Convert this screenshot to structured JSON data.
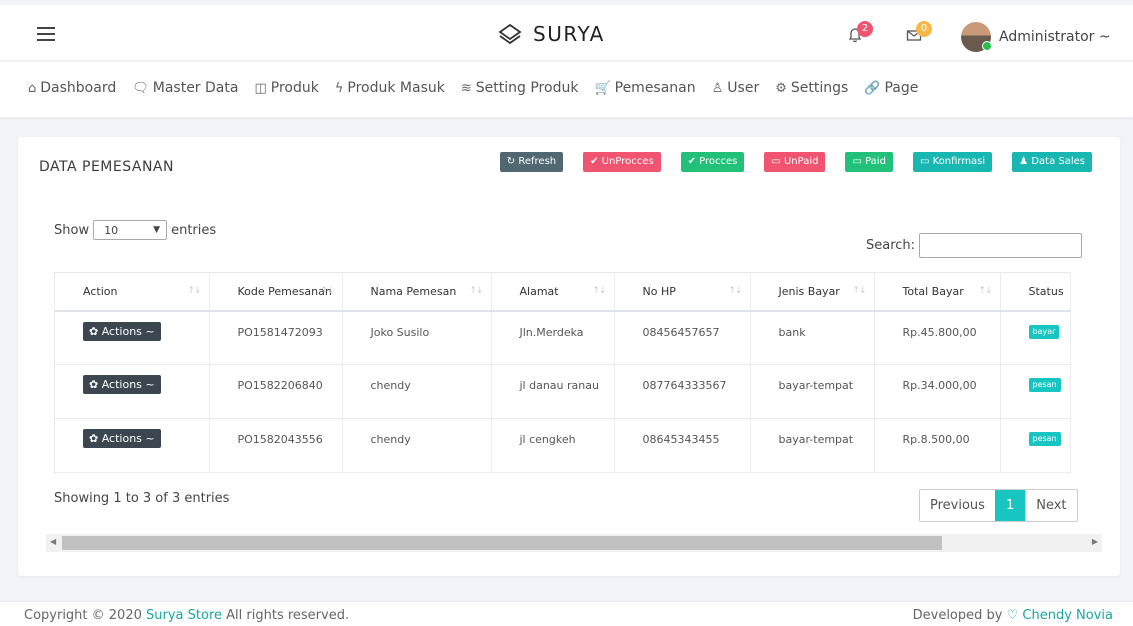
{
  "header": {
    "brand": "SURYA",
    "notif_count": "2",
    "mail_count": "0",
    "user": "Administrator ~"
  },
  "menu": [
    {
      "icon": "⌂",
      "icon_name": "home-icon",
      "label": "Dashboard"
    },
    {
      "icon": "🗨",
      "icon_name": "monitor-icon",
      "label": "Master Data"
    },
    {
      "icon": "◫",
      "icon_name": "grid-icon",
      "label": "Produk"
    },
    {
      "icon": "ϟ",
      "icon_name": "bolt-icon",
      "label": "Produk Masuk"
    },
    {
      "icon": "≋",
      "icon_name": "layers-icon",
      "label": "Setting Produk"
    },
    {
      "icon": "🛒",
      "icon_name": "cart-icon",
      "label": "Pemesanan"
    },
    {
      "icon": "♙",
      "icon_name": "user-icon",
      "label": "User"
    },
    {
      "icon": "⚙",
      "icon_name": "gear-icon",
      "label": "Settings"
    },
    {
      "icon": "🔗",
      "icon_name": "link-icon",
      "label": "Page"
    }
  ],
  "card": {
    "title": "DATA PEMESANAN",
    "buttons": [
      {
        "label": "↻ Refresh",
        "color": "#516872",
        "name": "refresh-button"
      },
      {
        "label": "✔ UnProcces",
        "color": "#f05471",
        "name": "unprocces-button"
      },
      {
        "label": "✔ Procces",
        "color": "#21c17a",
        "name": "procces-button"
      },
      {
        "label": "▭ UnPaid",
        "color": "#f05471",
        "name": "unpaid-button"
      },
      {
        "label": "▭ Paid",
        "color": "#21c17a",
        "name": "paid-button"
      },
      {
        "label": "▭ Konfirmasi",
        "color": "#18b7b2",
        "name": "konfirmasi-button"
      },
      {
        "label": "♟ Data Sales",
        "color": "#18b7b2",
        "name": "data-sales-button"
      }
    ]
  },
  "table": {
    "show": "Show",
    "entries_value": "10",
    "entries": "entries",
    "search_label": "Search:",
    "columns": [
      "Action",
      "Kode Pemesanan",
      "Nama Pemesan",
      "Alamat",
      "No HP",
      "Jenis Bayar",
      "Total Bayar",
      "Status"
    ],
    "action_label": "✿ Actions ~",
    "rows": [
      {
        "kode": "PO1581472093",
        "nama": "Joko Susilo",
        "alamat": "Jln.Merdeka",
        "hp": "08456457657",
        "jenis": "bank",
        "total": "Rp.45.800,00",
        "status": "bayar"
      },
      {
        "kode": "PO1582206840",
        "nama": "chendy",
        "alamat": "jl danau ranau",
        "hp": "087764333567",
        "jenis": "bayar-tempat",
        "total": "Rp.34.000,00",
        "status": "pesan"
      },
      {
        "kode": "PO1582043556",
        "nama": "chendy",
        "alamat": "jl cengkeh",
        "hp": "08645343455",
        "jenis": "bayar-tempat",
        "total": "Rp.8.500,00",
        "status": "pesan"
      }
    ],
    "info": "Showing 1 to 3 of 3 entries",
    "prev": "Previous",
    "page": "1",
    "next": "Next"
  },
  "footer": {
    "left_pre": "Copyright © 2020 ",
    "left_link": "Surya Store",
    "left_post": " All rights reserved.",
    "right_pre": "Developed by ",
    "heart": "♡",
    "right_link": "Chendy Novia"
  }
}
